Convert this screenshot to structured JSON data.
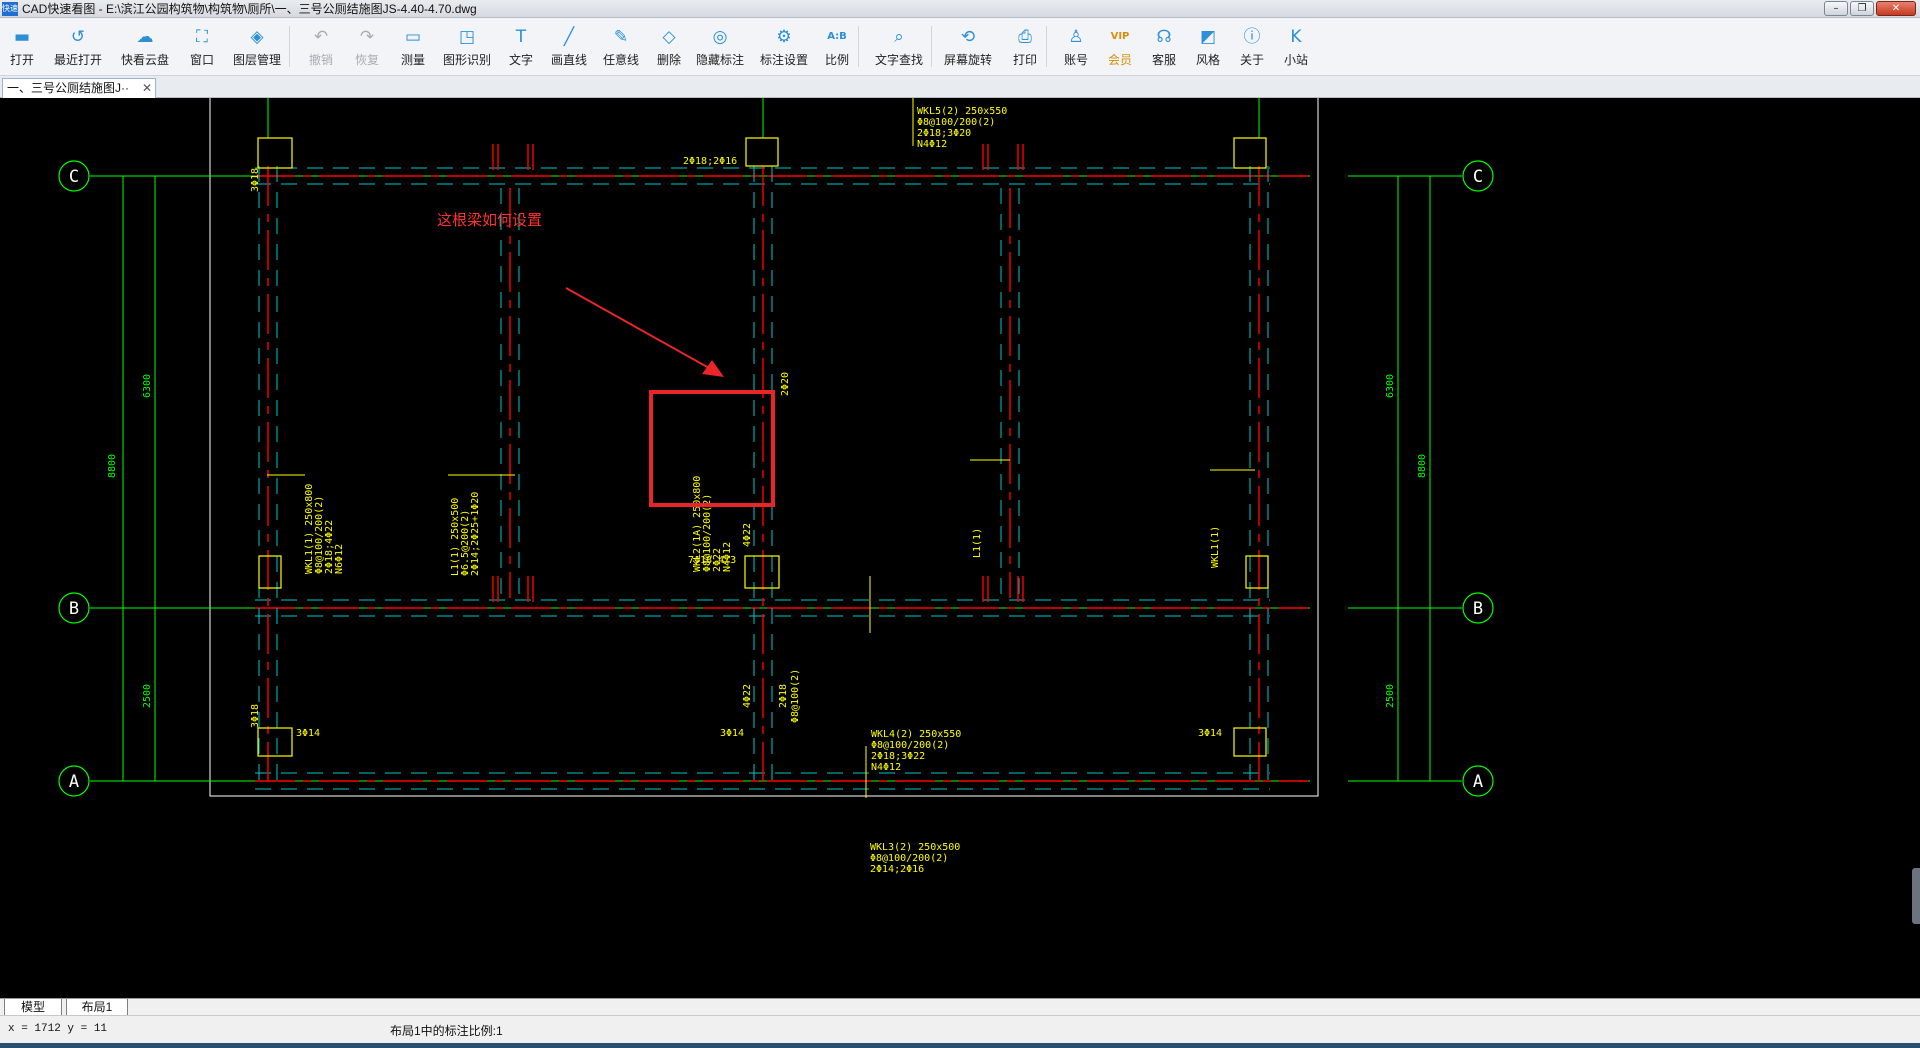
{
  "window": {
    "title": "CAD快速看图 - E:\\滨江公园构筑物\\构筑物\\厕所\\一、三号公厕结施图JS-4.40-4.70.dwg",
    "logo_text": "快速",
    "buttons": {
      "minimize": "–",
      "maximize": "❐",
      "close": "✕"
    }
  },
  "toolbar": {
    "items": [
      {
        "id": "open",
        "label": "打开",
        "icon": "folder-open-icon",
        "glyph": "▬",
        "enabled": true
      },
      {
        "id": "recent",
        "label": "最近打开",
        "icon": "history-icon",
        "glyph": "↺",
        "enabled": true
      },
      {
        "id": "cloud",
        "label": "快看云盘",
        "icon": "cloud-icon",
        "glyph": "☁",
        "enabled": true
      },
      {
        "id": "window",
        "label": "窗口",
        "icon": "window-fit-icon",
        "glyph": "⛶",
        "enabled": true
      },
      {
        "id": "layers",
        "label": "图层管理",
        "icon": "layers-icon",
        "glyph": "◈",
        "enabled": true
      },
      {
        "id": "undo",
        "label": "撤销",
        "icon": "undo-icon",
        "glyph": "↶",
        "enabled": false
      },
      {
        "id": "redo",
        "label": "恢复",
        "icon": "redo-icon",
        "glyph": "↷",
        "enabled": false
      },
      {
        "id": "measure",
        "label": "测量",
        "icon": "ruler-icon",
        "glyph": "▭",
        "enabled": true
      },
      {
        "id": "shape-recognize",
        "label": "图形识别",
        "icon": "shape-recognize-icon",
        "glyph": "◳",
        "enabled": true
      },
      {
        "id": "text",
        "label": "文字",
        "icon": "text-icon",
        "glyph": "T",
        "enabled": true
      },
      {
        "id": "line",
        "label": "画直线",
        "icon": "line-icon",
        "glyph": "╱",
        "enabled": true
      },
      {
        "id": "freeline",
        "label": "任意线",
        "icon": "pen-icon",
        "glyph": "✎",
        "enabled": true
      },
      {
        "id": "delete",
        "label": "删除",
        "icon": "eraser-icon",
        "glyph": "◇",
        "enabled": true
      },
      {
        "id": "hide-annot",
        "label": "隐藏标注",
        "icon": "eye-hidden-icon",
        "glyph": "◎",
        "enabled": true
      },
      {
        "id": "annot-settings",
        "label": "标注设置",
        "icon": "annotation-settings-icon",
        "glyph": "⚙",
        "enabled": true
      },
      {
        "id": "scale",
        "label": "比例",
        "icon": "scale-icon",
        "glyph": "A:B",
        "enabled": true
      },
      {
        "id": "text-search",
        "label": "文字查找",
        "icon": "text-search-icon",
        "glyph": "⌕",
        "enabled": true
      },
      {
        "id": "rotate",
        "label": "屏幕旋转",
        "icon": "rotate-screen-icon",
        "glyph": "⟲",
        "enabled": true
      },
      {
        "id": "print",
        "label": "打印",
        "icon": "printer-icon",
        "glyph": "⎙",
        "enabled": true
      },
      {
        "id": "account",
        "label": "账号",
        "icon": "user-icon",
        "glyph": "♙",
        "enabled": true
      },
      {
        "id": "vip",
        "label": "会员",
        "icon": "vip-icon",
        "glyph": "VIP",
        "enabled": true
      },
      {
        "id": "service",
        "label": "客服",
        "icon": "headset-icon",
        "glyph": "☊",
        "enabled": true
      },
      {
        "id": "style",
        "label": "风格",
        "icon": "style-icon",
        "glyph": "◩",
        "enabled": true
      },
      {
        "id": "about",
        "label": "关于",
        "icon": "info-icon",
        "glyph": "ⓘ",
        "enabled": true
      },
      {
        "id": "station",
        "label": "小站",
        "icon": "station-icon",
        "glyph": "K",
        "enabled": true
      }
    ]
  },
  "document_tab": {
    "label": "一、三号公厕结施图J··",
    "close": "✕"
  },
  "drawing": {
    "axis_labels": {
      "top": "C",
      "middle": "B",
      "bottom": "A"
    },
    "dimensions": {
      "upper_span": "6300",
      "lower_span": "2500",
      "total": "8800"
    },
    "question_note": "这根梁如何设置",
    "annotations": {
      "wkl5": [
        "WKL5(2) 250x550",
        "Φ8@100/200(2)",
        "2Φ18;3Φ20",
        "N4Φ12"
      ],
      "wkl2": [
        "WKL2(1A) 250x800",
        "Φ8@100/200(2)",
        "2Φ22",
        "N4Φ12"
      ],
      "wkl1_left": [
        "WKL1(1) 250x800",
        "Φ8@100/200(2)",
        "2Φ18;4Φ22",
        "N6Φ12"
      ],
      "l1": [
        "L1(1) 250x500",
        "Φ6.5@200(2)",
        "2Φ14;2Φ25+1Φ20"
      ],
      "wkl4": [
        "WKL4(2) 250x550",
        "Φ8@100/200(2)",
        "2Φ18;3Φ22",
        "N4Φ12"
      ],
      "wkl3": [
        "WKL3(2) 250x500",
        "Φ8@100/200(2)",
        "2Φ14;2Φ16"
      ],
      "l1_right": "L1(1)",
      "wkl1_right": "WKL1(1)",
      "top_rebar": "2Φ18;2Φ16",
      "rebar_2c20": "2Φ20",
      "mid_rebar": "7Φ18 4/3",
      "rebar_4c22": "4Φ22",
      "bottom_left_rebar": "3Φ14",
      "bottom_mid_rebar": "3Φ14",
      "bottom_right_rebar": "3Φ14",
      "col_note_1": "3Φ18",
      "col_note_2": "3Φ18",
      "lower_rebar_a": "4Φ22",
      "lower_rebar_b": "2Φ18",
      "lower_rebar_c": "Φ8@100(2)"
    },
    "colors": {
      "axis": "#00ff00",
      "beam_solid": "#ff0000",
      "beam_dashed": "#00c8c8",
      "column": "#ffff00",
      "annotation": "#ffff00",
      "frame": "#ffffff",
      "highlight_box": "#e8262a"
    }
  },
  "layout_tabs": {
    "model": "模型",
    "layout1": "布局1"
  },
  "status": {
    "coords": "x = 1712  y = 11",
    "message": "布局1中的标注比例:1"
  }
}
